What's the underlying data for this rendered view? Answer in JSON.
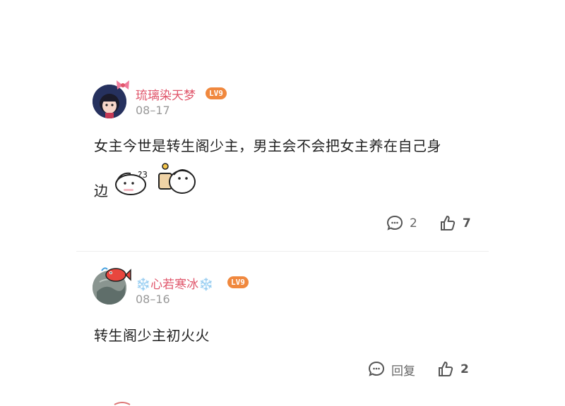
{
  "comments": [
    {
      "username": "琉璃染天梦",
      "level": "LV9",
      "date": "08–17",
      "text_line1": "女主今世是转生阁少主，男主会不会把女主养在自己身",
      "text_line2": "边",
      "reply_count": "2",
      "like_count": "7"
    },
    {
      "username": "❄️心若寒冰❄️",
      "level": "LV9",
      "date": "08–16",
      "text_line1": "转生阁少主初火火",
      "reply_label": "回复",
      "like_count": "2"
    }
  ],
  "icons": [
    "comment-icon",
    "thumbs-up-icon",
    "avatar-icon",
    "sticker-icon"
  ],
  "colors": {
    "username": "#e0566b",
    "level_badge": "#f0883e",
    "date": "#999999",
    "text": "#222222",
    "action": "#666666"
  }
}
